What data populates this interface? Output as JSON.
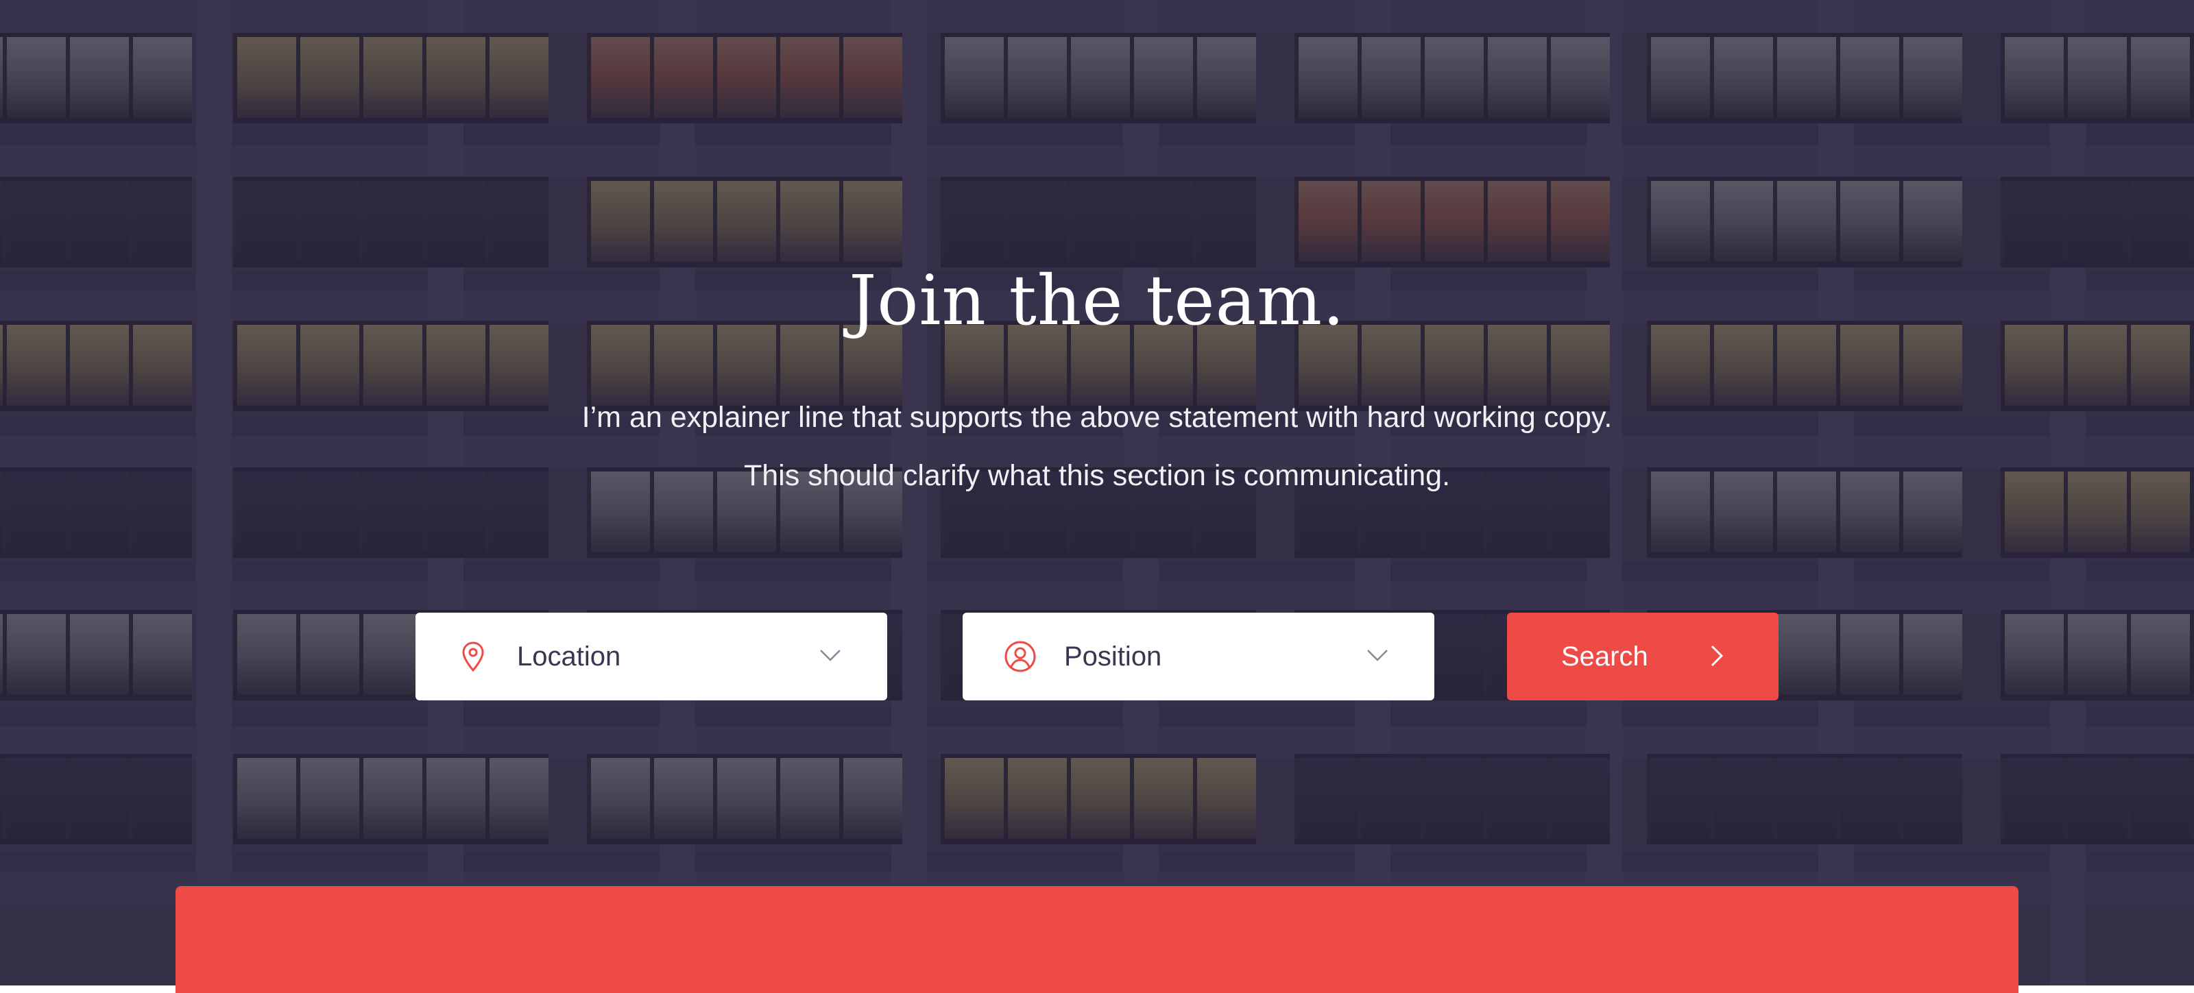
{
  "hero": {
    "headline": "Join the team.",
    "subline_1": "I’m an explainer line that supports the above statement with hard working copy.",
    "subline_2": "This should clarify what this section is communicating."
  },
  "filters": {
    "location": {
      "label": "Location",
      "icon": "map-pin-icon"
    },
    "position": {
      "label": "Position",
      "icon": "user-circle-icon"
    }
  },
  "search": {
    "label": "Search",
    "icon": "chevron-right-icon"
  },
  "colors": {
    "accent": "#ef4b46",
    "overlay": "#26213a",
    "select_text": "#3b3550"
  }
}
